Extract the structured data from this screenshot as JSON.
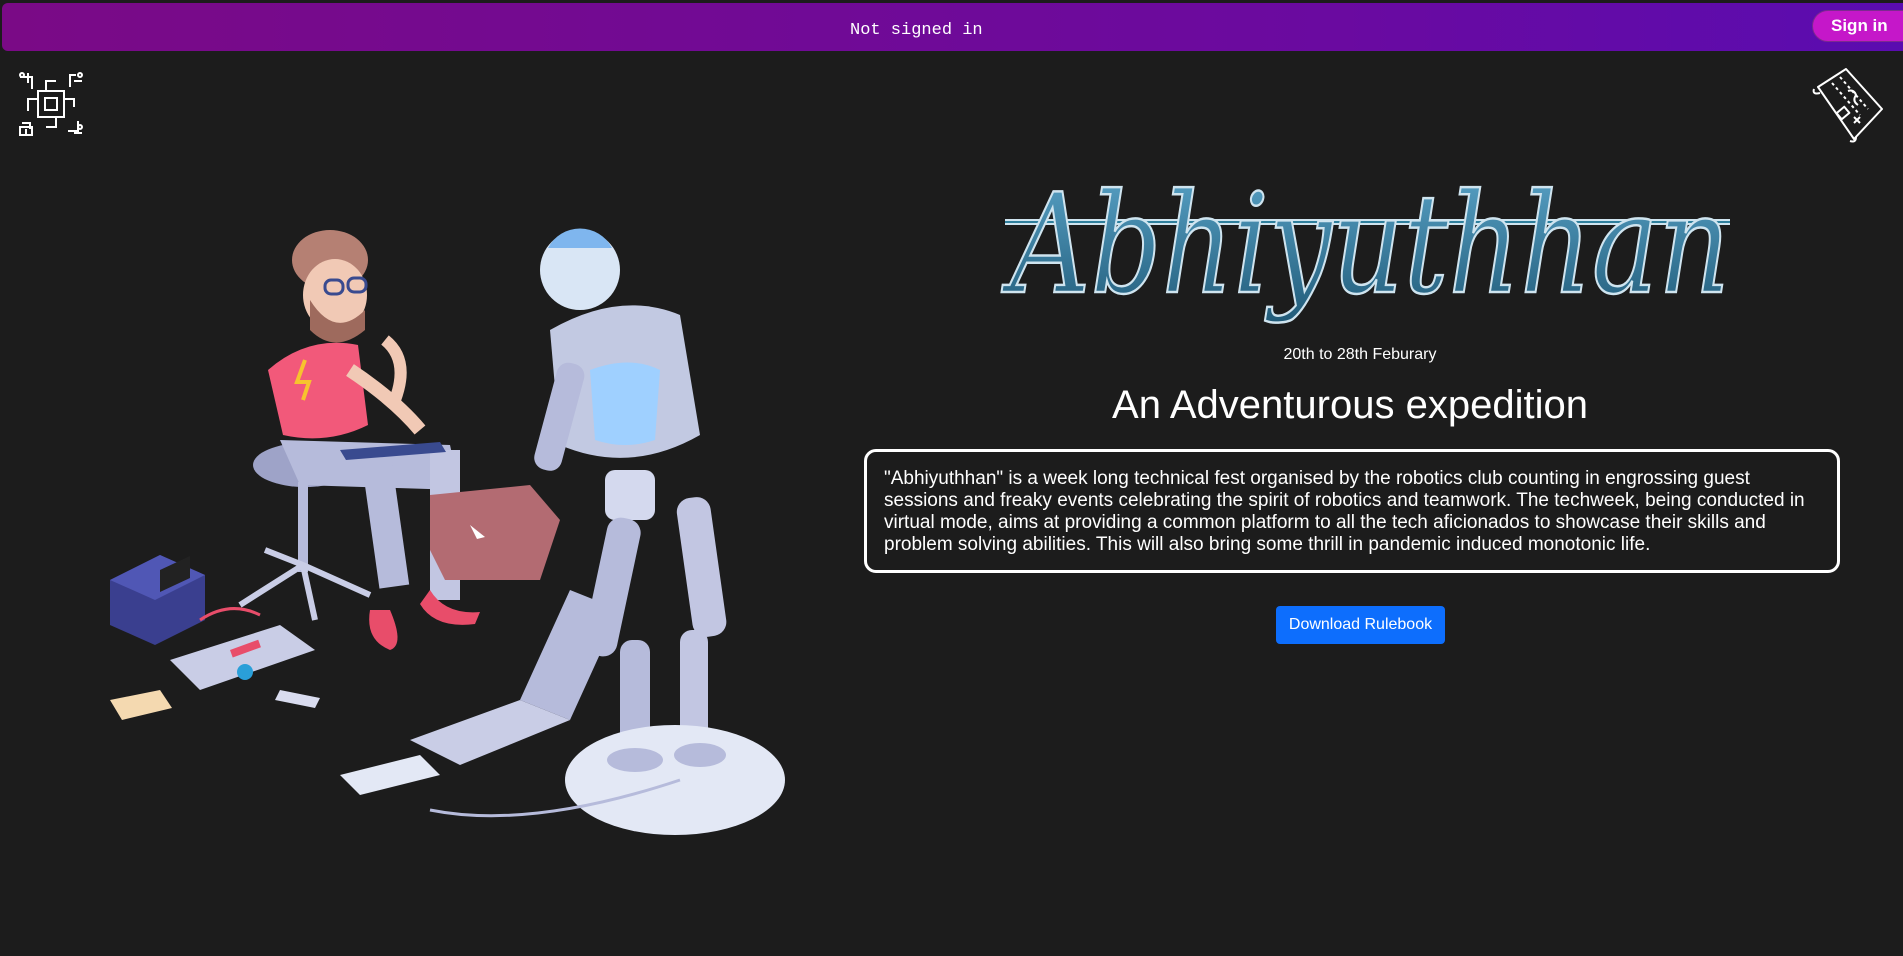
{
  "topbar": {
    "status_text": "Not signed in",
    "signin_label": "Sign in"
  },
  "icons": {
    "left_logo": "circuit-chip-icon",
    "right_logo": "treasure-map-icon"
  },
  "hero": {
    "illustration": "engineer-and-robot-illustration",
    "brand_title": "Abhiyuthhan",
    "dates": "20th to 28th Feburary",
    "tagline": "An Adventurous expedition",
    "description": "\"Abhiyuthhan\" is a week long technical fest organised by the robotics club counting in engrossing guest sessions and freaky events celebrating the spirit of robotics and teamwork. The techweek, being conducted in virtual mode, aims at providing a common platform to all the tech aficionados to showcase their skills and problem solving abilities. This will also bring some thrill in pandemic induced monotonic life.",
    "download_label": "Download Rulebook"
  },
  "colors": {
    "background": "#1c1c1c",
    "topbar_start": "#7a0a86",
    "topbar_end": "#5a0cb0",
    "signin_bg": "#c517c9",
    "brand_teal": "#2f7f9c",
    "download_bg": "#0d6efd"
  }
}
